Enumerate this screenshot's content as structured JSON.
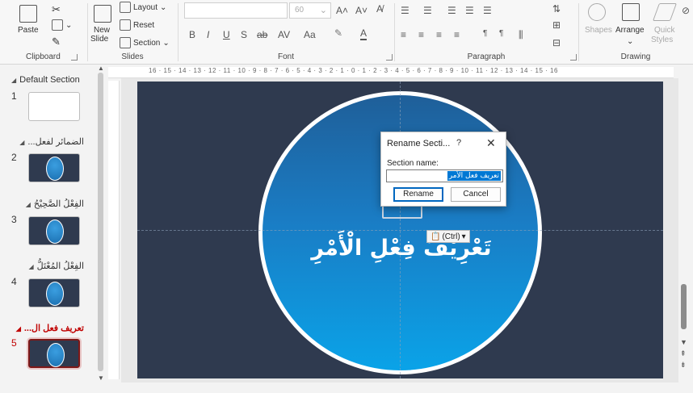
{
  "ribbon": {
    "clipboard": {
      "paste": "Paste",
      "group": "Clipboard"
    },
    "slides": {
      "new_slide_line1": "New",
      "new_slide_line2": "Slide",
      "layout": "Layout",
      "reset": "Reset",
      "section": "Section",
      "group": "Slides"
    },
    "font": {
      "size": "60",
      "group": "Font",
      "bold": "B",
      "italic": "I",
      "underline": "U",
      "shadow": "S",
      "strike": "ab",
      "spacing": "AV",
      "case": "Aa"
    },
    "paragraph": {
      "group": "Paragraph"
    },
    "drawing": {
      "shapes": "Shapes",
      "arrange": "Arrange",
      "quick_styles_line1": "Quick",
      "quick_styles_line2": "Styles",
      "group": "Drawing"
    }
  },
  "ruler_text": "16 · 15 · 14 · 13 · 12 · 11 · 10 · 9 · 8 · 7 · 6 · 5 · 4 · 3 · 2 · 1 · 0 · 1 · 2 · 3 · 4 · 5 · 6 · 7 · 8 · 9 · 10 · 11 · 12 · 13 · 14 · 15 · 16",
  "sections": [
    {
      "name": "Default Section",
      "slide_num": "1"
    },
    {
      "name": "الضمائر لفعل...",
      "slide_num": "2"
    },
    {
      "name": "الفِعْلُ الصَّحِيْحُ",
      "slide_num": "3"
    },
    {
      "name": "الفِعْلُ المُعْتَلُّ",
      "slide_num": "4"
    },
    {
      "name": "تعريف فعل ال...",
      "slide_num": "5"
    }
  ],
  "slide": {
    "title": "تَعْرِيْفُ فِعْلِ الْأَمْرِ",
    "paste_options": "(Ctrl)"
  },
  "dialog": {
    "title": "Rename Secti...",
    "help": "?",
    "close": "✕",
    "label": "Section name:",
    "value": "تعريف فعل الأمر",
    "rename": "Rename",
    "cancel": "Cancel"
  },
  "colors": {
    "slide_bg": "#2f3a4f",
    "accent": "#0078d4",
    "selected_section": "#c00000"
  }
}
